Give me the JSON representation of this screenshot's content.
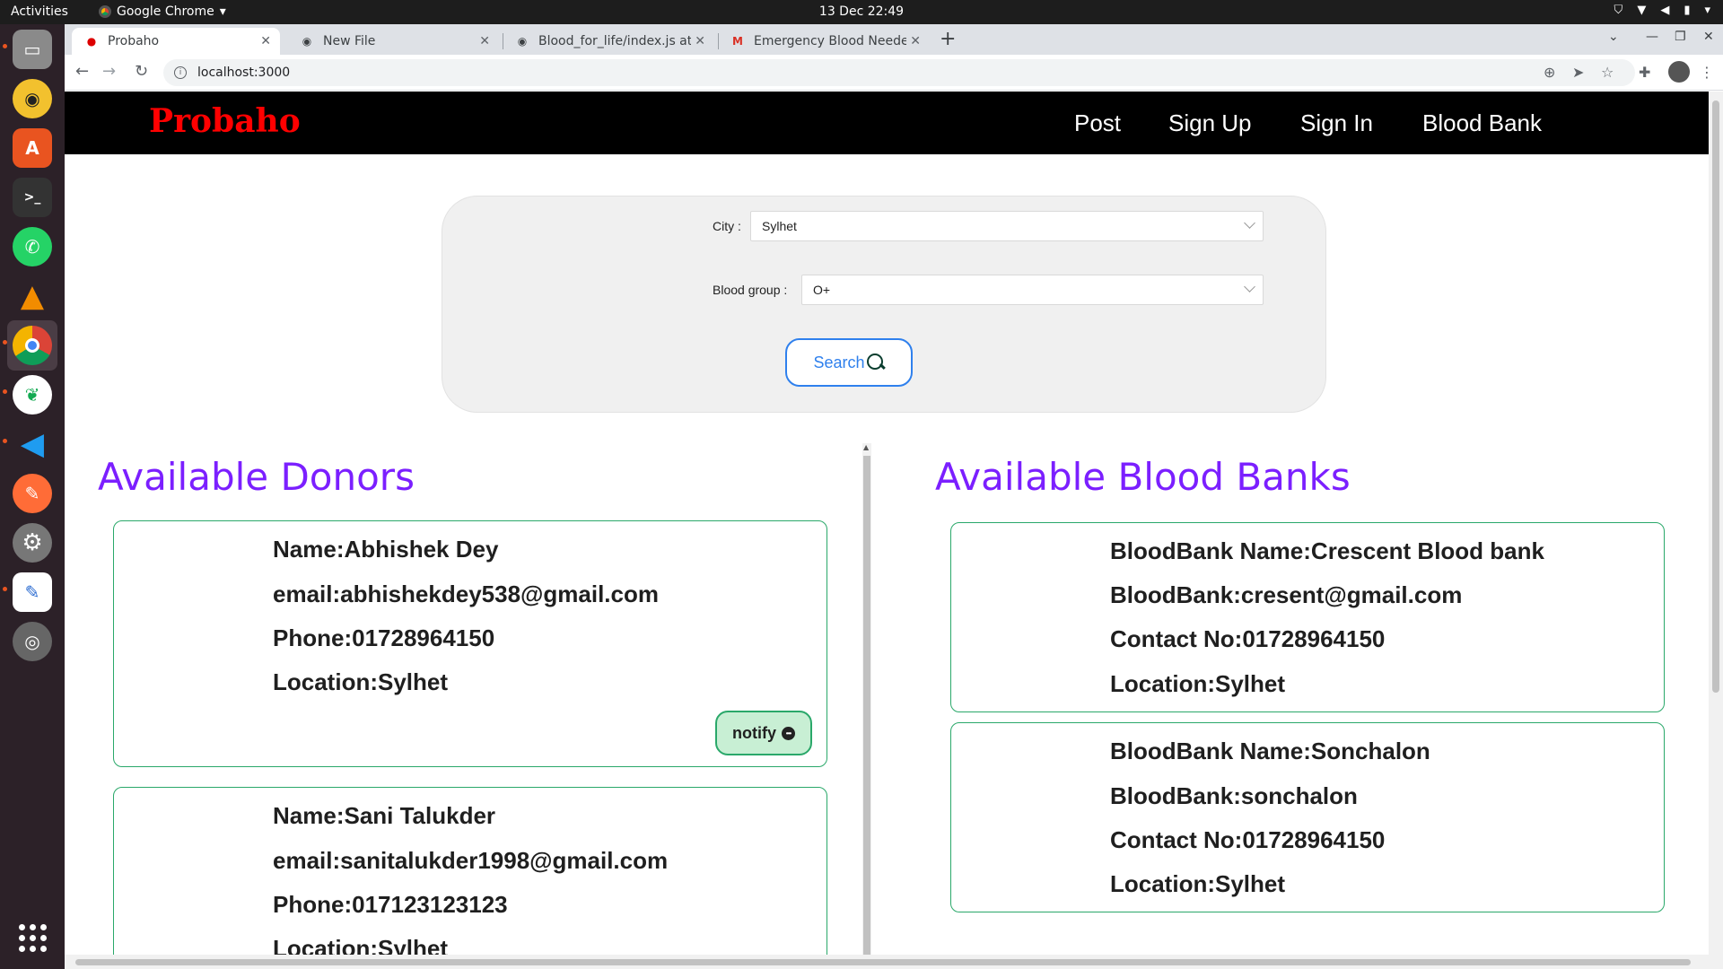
{
  "os": {
    "activities": "Activities",
    "app_menu": "Google Chrome",
    "clock": "13 Dec  22:49"
  },
  "browser": {
    "tabs": [
      {
        "title": "Probaho",
        "active": true
      },
      {
        "title": "New File",
        "active": false
      },
      {
        "title": "Blood_for_life/index.js at",
        "active": false
      },
      {
        "title": "Emergency Blood Needed",
        "active": false
      }
    ],
    "url": "localhost:3000"
  },
  "site": {
    "brand": "Probaho",
    "nav": [
      "Post",
      "Sign Up",
      "Sign In",
      "Blood Bank"
    ]
  },
  "search": {
    "city_label": "City",
    "city_value": "Sylhet",
    "blood_group_label": "Blood group",
    "blood_group_value": "O+",
    "button_label": "Search"
  },
  "donors": {
    "title": "Available Donors",
    "notify_label": "notify",
    "items": [
      {
        "name": "Name:Abhishek Dey",
        "email": "email:abhishekdey538@gmail.com",
        "phone": "Phone:01728964150",
        "location": "Location:Sylhet"
      },
      {
        "name": "Name:Sani Talukder",
        "email": "email:sanitalukder1998@gmail.com",
        "phone": "Phone:017123123123",
        "location": "Location:Sylhet"
      }
    ]
  },
  "banks": {
    "title": "Available Blood Banks",
    "items": [
      {
        "name": "BloodBank Name:Crescent Blood bank",
        "email": "BloodBank:cresent@gmail.com",
        "contact": "Contact No:01728964150",
        "location": "Location:Sylhet"
      },
      {
        "name": "BloodBank Name:Sonchalon",
        "email": "BloodBank:sonchalon",
        "contact": "Contact No:01728964150",
        "location": "Location:Sylhet"
      }
    ]
  },
  "colors": {
    "brand": "#ff0000",
    "section_title": "#7b1fff",
    "card_border": "#2aa86a",
    "search_accent": "#2f80ed"
  }
}
